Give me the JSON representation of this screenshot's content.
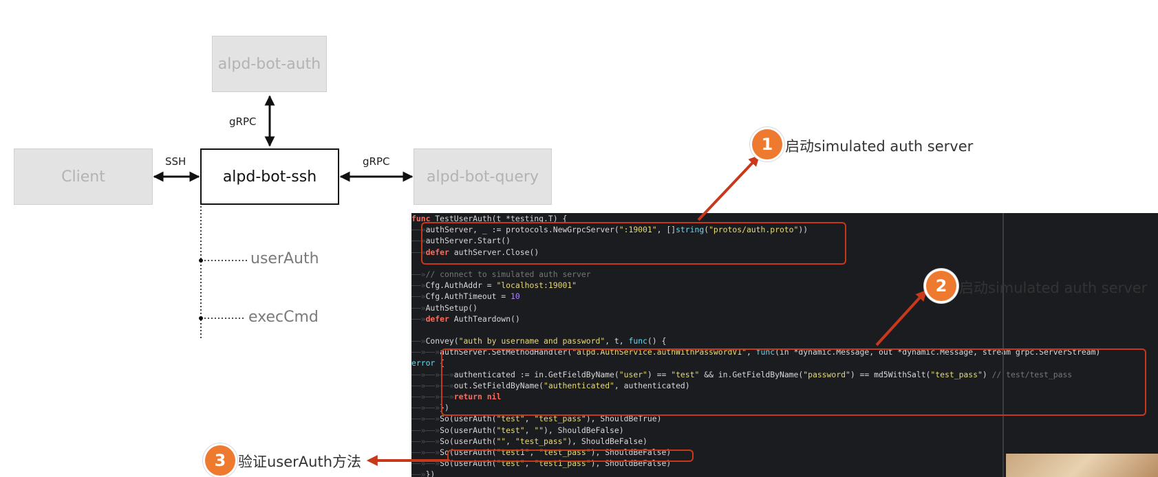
{
  "diagram": {
    "nodes": {
      "auth": "alpd-bot-auth",
      "client": "Client",
      "ssh": "alpd-bot-ssh",
      "query": "alpd-bot-query"
    },
    "edges": {
      "ssh_auth": "gRPC",
      "client_ssh": "SSH",
      "ssh_query": "gRPC"
    },
    "calls": [
      "userAuth",
      "execCmd"
    ]
  },
  "callouts": [
    {
      "number": "1",
      "text": "启动simulated auth server"
    },
    {
      "number": "2",
      "text": "启动simulated auth server"
    },
    {
      "number": "3",
      "text": "验证userAuth方法"
    }
  ],
  "colors": {
    "accent_orange": "#ee7a30",
    "arrow_red": "#c8391c",
    "code_bg": "#1b1c20"
  },
  "code": [
    [
      [
        "func ",
        "kw"
      ],
      [
        "TestUserAuth(t *testing.T) {",
        "p"
      ]
    ],
    [
      [
        "——»",
        "ws"
      ],
      [
        "authServer, _ := protocols.NewGrpcServer(",
        "p"
      ],
      [
        "\":19001\"",
        "str"
      ],
      [
        ", []",
        "p"
      ],
      [
        "string",
        "fn"
      ],
      [
        "(",
        "p"
      ],
      [
        "\"protos/auth.proto\"",
        "str"
      ],
      [
        "))",
        "p"
      ]
    ],
    [
      [
        "——»",
        "ws"
      ],
      [
        "authServer.Start()",
        "p"
      ]
    ],
    [
      [
        "——»",
        "ws"
      ],
      [
        "defer ",
        "kw"
      ],
      [
        "authServer.Close()",
        "p"
      ]
    ],
    [
      [
        "",
        "p"
      ]
    ],
    [
      [
        "——»",
        "ws"
      ],
      [
        "// connect to simulated auth server",
        "com"
      ]
    ],
    [
      [
        "——»",
        "ws"
      ],
      [
        "Cfg.AuthAddr = ",
        "p"
      ],
      [
        "\"localhost:19001\"",
        "str"
      ]
    ],
    [
      [
        "——»",
        "ws"
      ],
      [
        "Cfg.AuthTimeout = ",
        "p"
      ],
      [
        "10",
        "num"
      ]
    ],
    [
      [
        "——»",
        "ws"
      ],
      [
        "AuthSetup()",
        "p"
      ]
    ],
    [
      [
        "——»",
        "ws"
      ],
      [
        "defer ",
        "kw"
      ],
      [
        "AuthTeardown()",
        "p"
      ]
    ],
    [
      [
        "",
        "p"
      ]
    ],
    [
      [
        "——»",
        "ws"
      ],
      [
        "Convey(",
        "p"
      ],
      [
        "\"auth by username and password\"",
        "str"
      ],
      [
        ", t, ",
        "p"
      ],
      [
        "func",
        "fn"
      ],
      [
        "() {",
        "p"
      ]
    ],
    [
      [
        "——»——»",
        "ws"
      ],
      [
        "authServer.SetMethodHandler(",
        "p"
      ],
      [
        "\"alpd.AuthService.authWithPasswordV1\"",
        "str"
      ],
      [
        ", ",
        "p"
      ],
      [
        "func",
        "fn"
      ],
      [
        "(in *dynamic.Message, out *dynamic.Message, stream grpc.ServerStream)",
        "p"
      ]
    ],
    [
      [
        "error",
        "fn"
      ],
      [
        " {",
        "p"
      ]
    ],
    [
      [
        "——»——»——»",
        "ws"
      ],
      [
        "authenticated := in.GetFieldByName(",
        "p"
      ],
      [
        "\"user\"",
        "str"
      ],
      [
        ") == ",
        "p"
      ],
      [
        "\"test\"",
        "str"
      ],
      [
        " && in.GetFieldByName(",
        "p"
      ],
      [
        "\"password\"",
        "str"
      ],
      [
        ") == md5WithSalt(",
        "p"
      ],
      [
        "\"test_pass\"",
        "str"
      ],
      [
        ") ",
        "p"
      ],
      [
        "// test/test_pass",
        "com"
      ]
    ],
    [
      [
        "——»——»——»",
        "ws"
      ],
      [
        "out.SetFieldByName(",
        "p"
      ],
      [
        "\"authenticated\"",
        "str"
      ],
      [
        ", authenticated)",
        "p"
      ]
    ],
    [
      [
        "——»——»——»",
        "ws"
      ],
      [
        "return nil",
        "kw"
      ]
    ],
    [
      [
        "——»——»",
        "ws"
      ],
      [
        "})",
        "p"
      ]
    ],
    [
      [
        "——»——»",
        "ws"
      ],
      [
        "So(userAuth(",
        "p"
      ],
      [
        "\"test\"",
        "str"
      ],
      [
        ", ",
        "p"
      ],
      [
        "\"test_pass\"",
        "str"
      ],
      [
        "), ShouldBeTrue)",
        "p"
      ]
    ],
    [
      [
        "——»——»",
        "ws"
      ],
      [
        "So(userAuth(",
        "p"
      ],
      [
        "\"test\"",
        "str"
      ],
      [
        ", ",
        "p"
      ],
      [
        "\"\"",
        "str"
      ],
      [
        "), ShouldBeFalse)",
        "p"
      ]
    ],
    [
      [
        "——»——»",
        "ws"
      ],
      [
        "So(userAuth(",
        "p"
      ],
      [
        "\"\"",
        "str"
      ],
      [
        ", ",
        "p"
      ],
      [
        "\"test_pass\"",
        "str"
      ],
      [
        "), ShouldBeFalse)",
        "p"
      ]
    ],
    [
      [
        "——»——»",
        "ws"
      ],
      [
        "So(userAuth(",
        "p"
      ],
      [
        "\"test1\"",
        "str"
      ],
      [
        ", ",
        "p"
      ],
      [
        "\"test_pass\"",
        "str"
      ],
      [
        "), ShouldBeFalse)",
        "p"
      ]
    ],
    [
      [
        "——»——»",
        "ws"
      ],
      [
        "So(userAuth(",
        "p"
      ],
      [
        "\"test\"",
        "str"
      ],
      [
        ", ",
        "p"
      ],
      [
        "\"test1_pass\"",
        "str"
      ],
      [
        "), ShouldBeFalse)",
        "p"
      ]
    ],
    [
      [
        "——»",
        "ws"
      ],
      [
        "})",
        "p"
      ]
    ]
  ]
}
